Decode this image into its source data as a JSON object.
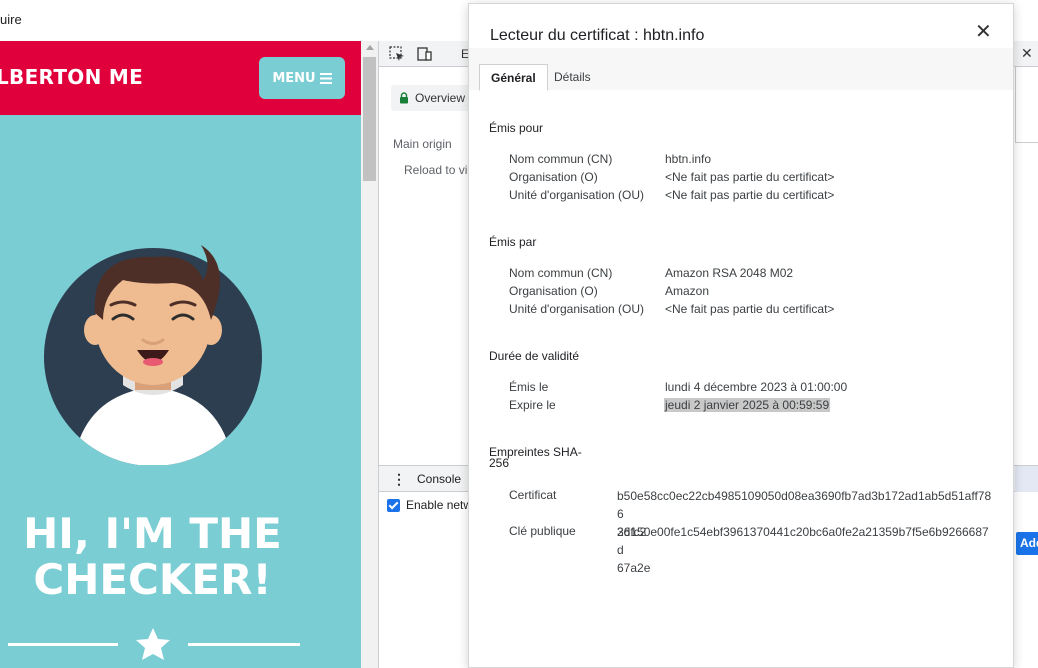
{
  "browser": {
    "breadcrumb": "uire"
  },
  "site": {
    "brand": "LBERTON ME",
    "menu_label": "MENU",
    "hero_line1": "HI, I'M THE",
    "hero_line2": "CHECKER!",
    "colors": {
      "header": "#e0003c",
      "background": "#79cdd3"
    }
  },
  "devtools": {
    "tab_elements": "El",
    "overview": "Overview",
    "main_origin": "Main origin",
    "reload_text": "Reload to vie",
    "console_label": "Console",
    "enable_label": "Enable netw",
    "add_label": "Add"
  },
  "dialog": {
    "title": "Lecteur du certificat : hbtn.info",
    "tabs": [
      {
        "label": "Général",
        "active": true
      },
      {
        "label": "Détails",
        "active": false
      }
    ],
    "issued_to": {
      "heading": "Émis pour",
      "rows": [
        {
          "label": "Nom commun (CN)",
          "value": "hbtn.info"
        },
        {
          "label": "Organisation (O)",
          "value": "<Ne fait pas partie du certificat>"
        },
        {
          "label": "Unité d'organisation (OU)",
          "value": "<Ne fait pas partie du certificat>"
        }
      ]
    },
    "issued_by": {
      "heading": "Émis par",
      "rows": [
        {
          "label": "Nom commun (CN)",
          "value": "Amazon RSA 2048 M02"
        },
        {
          "label": "Organisation (O)",
          "value": "Amazon"
        },
        {
          "label": "Unité d'organisation (OU)",
          "value": "<Ne fait pas partie du certificat>"
        }
      ]
    },
    "validity": {
      "heading": "Durée de validité",
      "rows": [
        {
          "label": "Émis le",
          "value": "lundi 4 décembre 2023 à 01:00:00"
        },
        {
          "label": "Expire le",
          "value": "jeudi 2 janvier 2025 à 00:59:59"
        }
      ]
    },
    "fingerprints": {
      "heading_line1": "Empreintes SHA-",
      "heading_line2": "256",
      "rows": [
        {
          "label": "Certificat",
          "line1": "b50e58cc0ec22cb4985109050d08ea3690fb7ad3b172ad1ab5d51aff786",
          "line2": "26fc2"
        },
        {
          "label": "Clé publique",
          "line1": "3d150e00fe1c54ebf3961370441c20bc6a0fe2a21359b7f5e6b9266687d",
          "line2": "67a2e"
        }
      ]
    }
  }
}
